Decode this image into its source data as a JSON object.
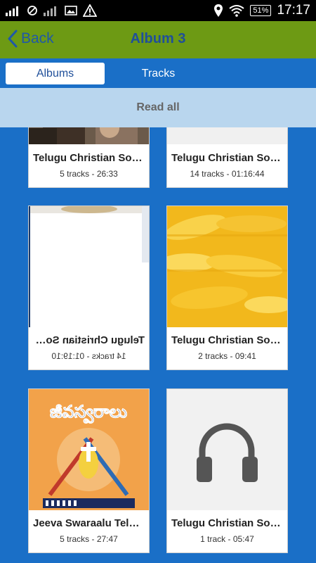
{
  "statusbar": {
    "battery": "51%",
    "time": "17:17"
  },
  "header": {
    "back_label": "Back",
    "title": "Album 3"
  },
  "tabs": [
    {
      "label": "Albums",
      "active": true
    },
    {
      "label": "Tracks",
      "active": false
    }
  ],
  "read_all_label": "Read all",
  "albums": [
    {
      "name": "Telugu Christian Songs",
      "info": "5 tracks - 26:33"
    },
    {
      "name": "Telugu Christian Songs",
      "info": "14 tracks - 01:16:44"
    },
    {
      "name": "Telugu Christian Songs",
      "info": "14 tracks - 01:19:10"
    },
    {
      "name": "Telugu Christian Songs",
      "info": "2 tracks - 09:41"
    },
    {
      "name": "Jeeva Swaraalu Telug...",
      "info": "5 tracks - 27:47"
    },
    {
      "name": "Telugu Christian Songs",
      "info": "1 track - 05:47"
    }
  ],
  "album_cover_text": "జీవస్వరాలు",
  "colors": {
    "header": "#6d9a14",
    "background": "#1a6fc7",
    "read_all_bar": "#b9d6ee",
    "title": "#1f4f9a"
  }
}
